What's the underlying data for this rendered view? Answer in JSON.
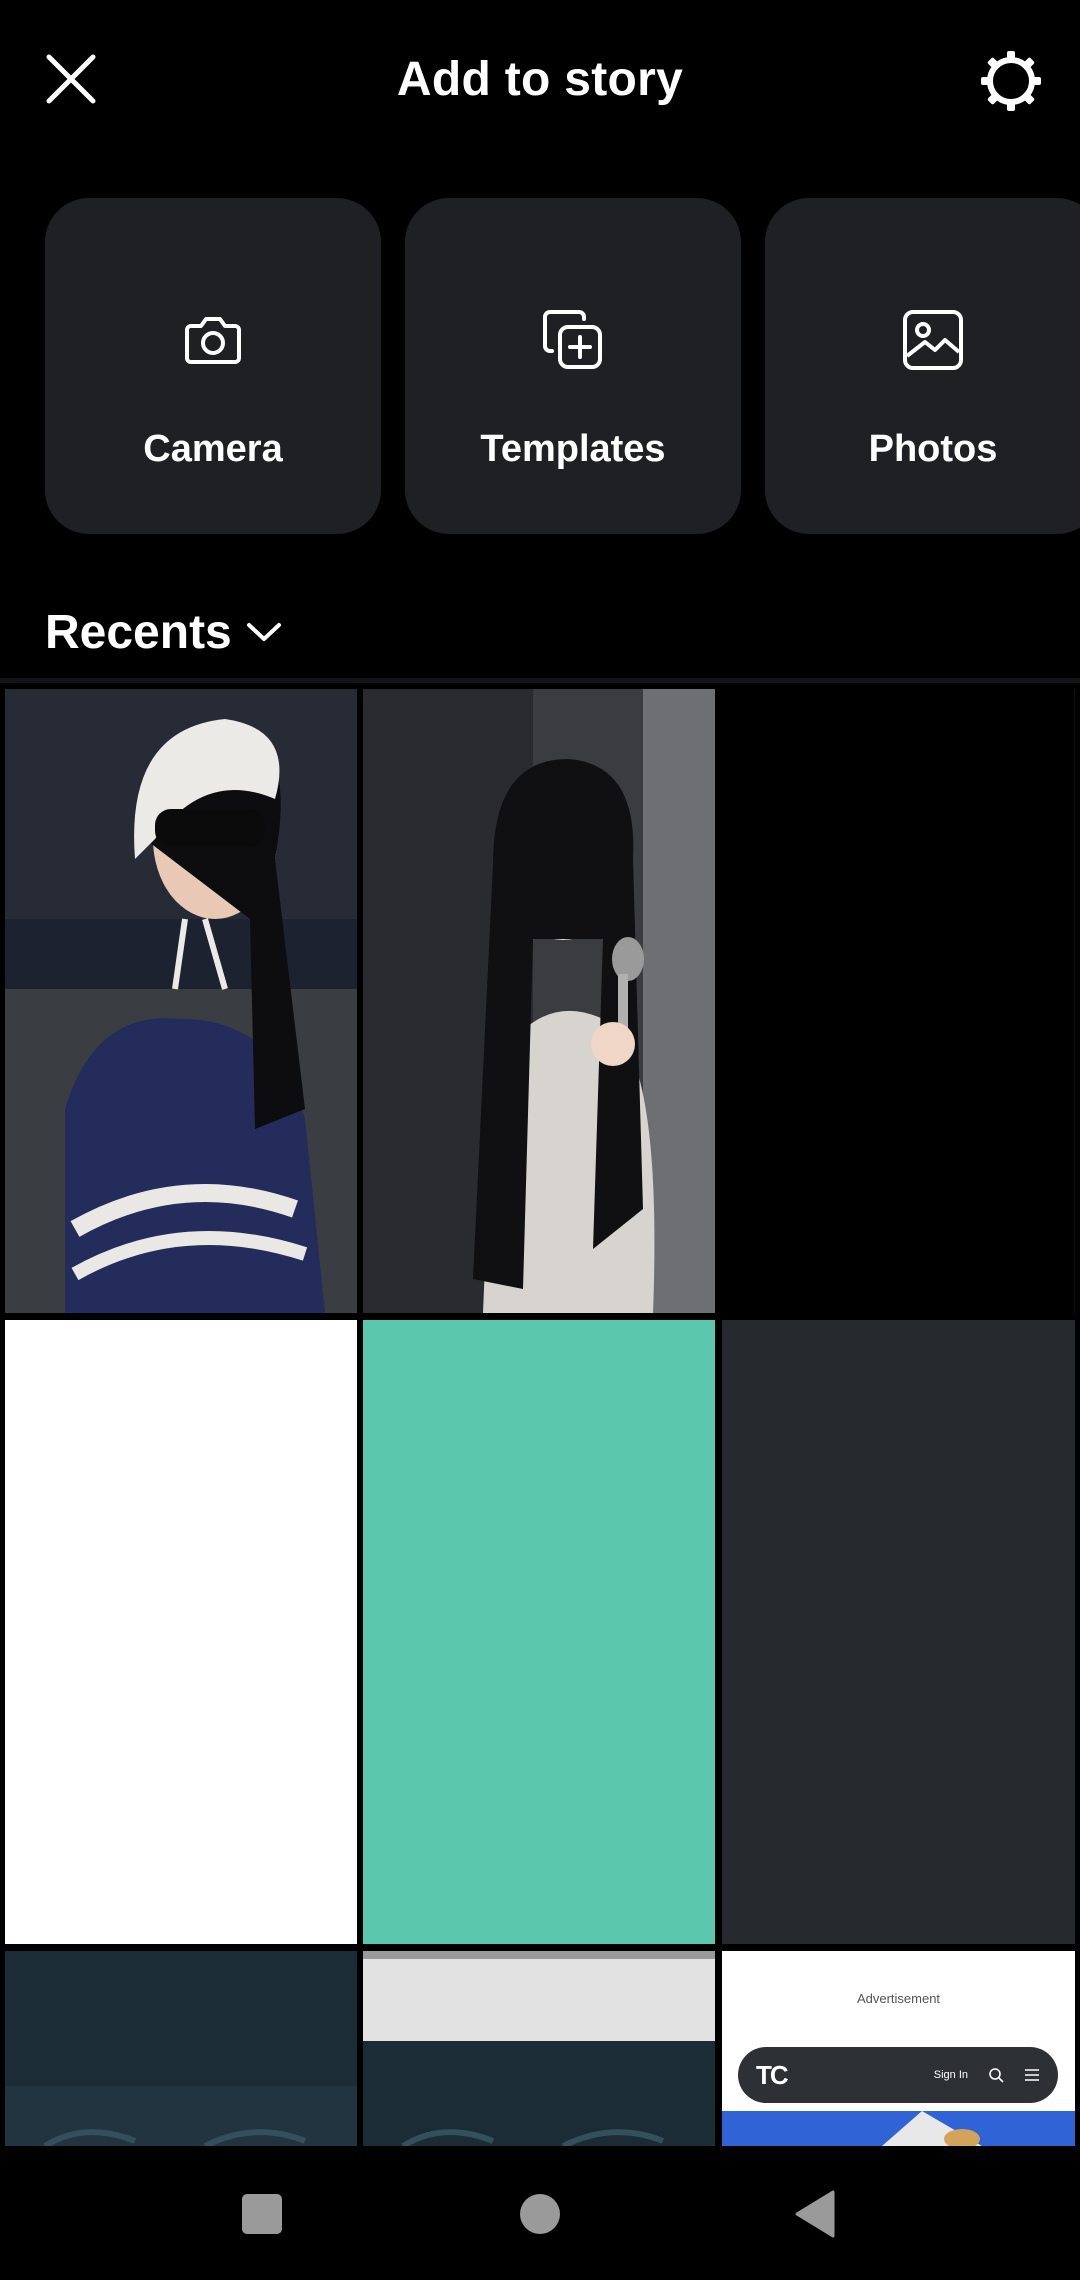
{
  "header": {
    "title": "Add to story",
    "close_icon": "close-icon",
    "settings_icon": "settings-gear-icon"
  },
  "options": [
    {
      "label": "Camera",
      "icon": "camera-icon"
    },
    {
      "label": "Templates",
      "icon": "templates-icon"
    },
    {
      "label": "Photos",
      "icon": "photos-icon"
    }
  ],
  "recents": {
    "label": "Recents",
    "icon": "chevron-down-icon"
  },
  "gallery": {
    "tile_colors": {
      "black": "#000000",
      "white": "#ffffff",
      "teal": "#5bc8ad",
      "charcoal": "#25282c"
    },
    "web_preview": {
      "ad_text": "Advertisement",
      "logo_text": "TC",
      "sign_in_text": "Sign In"
    }
  },
  "navbar": {
    "icons": [
      "recents-square-icon",
      "home-circle-icon",
      "back-triangle-icon"
    ]
  },
  "colors": {
    "background": "#000000",
    "card": "#1f2024",
    "text": "#ffffff"
  }
}
